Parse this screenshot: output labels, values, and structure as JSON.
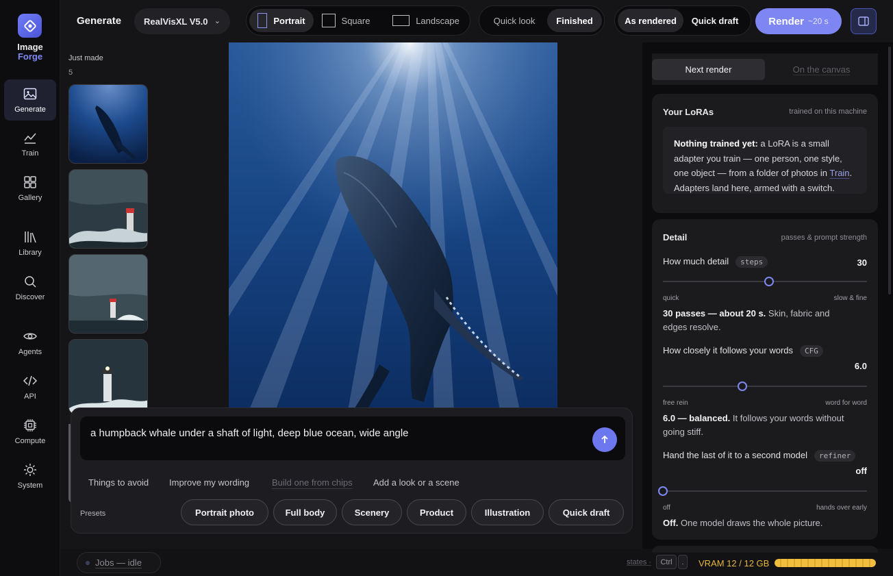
{
  "app": {
    "logo_line1": "Image",
    "logo_line2": "Forge"
  },
  "rail": [
    {
      "label": "Generate",
      "icon": "image-icon"
    },
    {
      "label": "Train",
      "icon": "chart-line-icon"
    },
    {
      "label": "Gallery",
      "icon": "grid-icon"
    },
    {
      "label": "Library",
      "icon": "books-icon"
    },
    {
      "label": "Discover",
      "icon": "search-icon"
    },
    {
      "label": "Agents",
      "icon": "eye-icon"
    },
    {
      "label": "API",
      "icon": "code-icon"
    },
    {
      "label": "Compute",
      "icon": "chip-icon"
    },
    {
      "label": "System",
      "icon": "sun-gear-icon"
    }
  ],
  "topbar": {
    "title": "Generate",
    "model": "RealVisXL V5.0",
    "aspect": [
      "Portrait",
      "Square",
      "Landscape"
    ],
    "aspect_selected": "Portrait",
    "quality": [
      "Quick look",
      "Finished"
    ],
    "quality_selected": "Finished",
    "mode": [
      "As rendered",
      "Quick draft"
    ],
    "render_label": "Render",
    "render_time": "~20 s"
  },
  "history": {
    "label": "Just made",
    "count": "5"
  },
  "prompt": {
    "text": "a humpback whale under a shaft of light, deep blue ocean, wide angle",
    "aids": [
      "Things to avoid",
      "Improve my wording",
      "Build one from chips",
      "Add a look or a scene"
    ],
    "presets_label": "Presets",
    "presets": [
      "Portrait photo",
      "Full body",
      "Scenery",
      "Product",
      "Illustration",
      "Quick draft"
    ]
  },
  "status": {
    "jobs": "Jobs — idle",
    "states": "states ·",
    "key1": "Ctrl",
    "key2": ".",
    "vram": "VRAM 12 / 12 GB",
    "vram_used_fraction": 1.0,
    "vram_color": "#f0bd3d"
  },
  "panel": {
    "tabs": [
      "Next render",
      "On the canvas"
    ],
    "loras": {
      "title": "Your LoRAs",
      "hint": "trained on this machine",
      "empty_bold": "Nothing trained yet:",
      "empty_text1": " a LoRA is a small adapter you train — one person, one style, one object — from a folder of photos in ",
      "empty_link": "Train",
      "empty_text2": ". Adapters land here, armed with a switch."
    },
    "detail": {
      "title": "Detail",
      "hint": "passes & prompt strength",
      "steps": {
        "label": "How much detail",
        "tag": "steps",
        "value": "30",
        "position_fraction": 0.52,
        "min_label": "quick",
        "max_label": "slow & fine",
        "note_bold": "30 passes — about 20 s.",
        "note_rest": " Skin, fabric and edges resolve."
      },
      "cfg": {
        "label": "How closely it follows your words",
        "tag": "CFG",
        "value": "6.0",
        "position_fraction": 0.39,
        "min_label": "free rein",
        "max_label": "word for word",
        "note_bold": "6.0 — balanced.",
        "note_rest": " It follows your words without going stiff."
      },
      "refiner": {
        "label": "Hand the last of it to a second model",
        "tag": "refiner",
        "value": "off",
        "position_fraction": 0.0,
        "min_label": "off",
        "max_label": "hands over early",
        "note_bold": "Off.",
        "note_rest": " One model draws the whole picture."
      }
    }
  },
  "colors": {
    "accent": "#7d86f2",
    "rail_active": "#1f2030",
    "vram": "#e8b73a"
  }
}
